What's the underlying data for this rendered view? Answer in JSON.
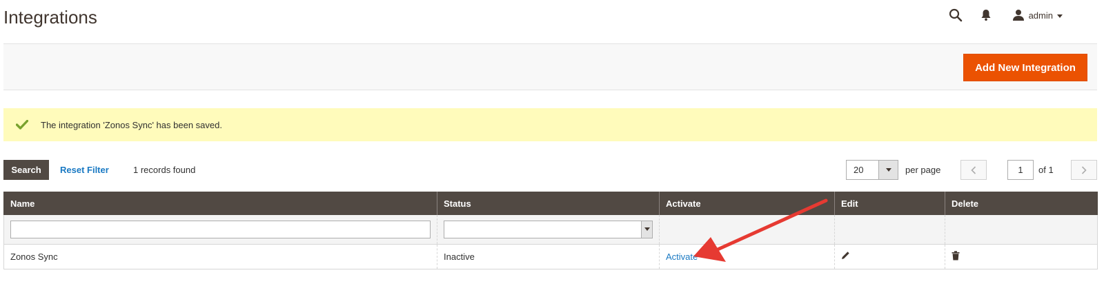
{
  "page": {
    "title": "Integrations"
  },
  "header": {
    "icons": {
      "search": "search-icon",
      "notifications": "bell-icon",
      "user": "user-icon"
    },
    "user_name": "admin"
  },
  "actions": {
    "add_new_label": "Add New Integration"
  },
  "message": {
    "text": "The integration 'Zonos Sync' has been saved.",
    "type": "success",
    "color": "#79a22e"
  },
  "toolbar": {
    "search_label": "Search",
    "reset_filter_label": "Reset Filter",
    "records_found": "1 records found",
    "per_page_value": "20",
    "per_page_label": "per page",
    "current_page": "1",
    "total_pages_label": "of 1"
  },
  "grid": {
    "columns": [
      "Name",
      "Status",
      "Activate",
      "Edit",
      "Delete"
    ],
    "rows": [
      {
        "name": "Zonos Sync",
        "status": "Inactive",
        "activate_link": "Activate",
        "edit_icon": "pencil-icon",
        "delete_icon": "trash-icon"
      }
    ]
  },
  "colors": {
    "primary_button": "#eb5202",
    "dark_button": "#514943",
    "link": "#1979c3",
    "message_bg": "#fffbbb",
    "annotation_arrow": "#e63a32"
  }
}
